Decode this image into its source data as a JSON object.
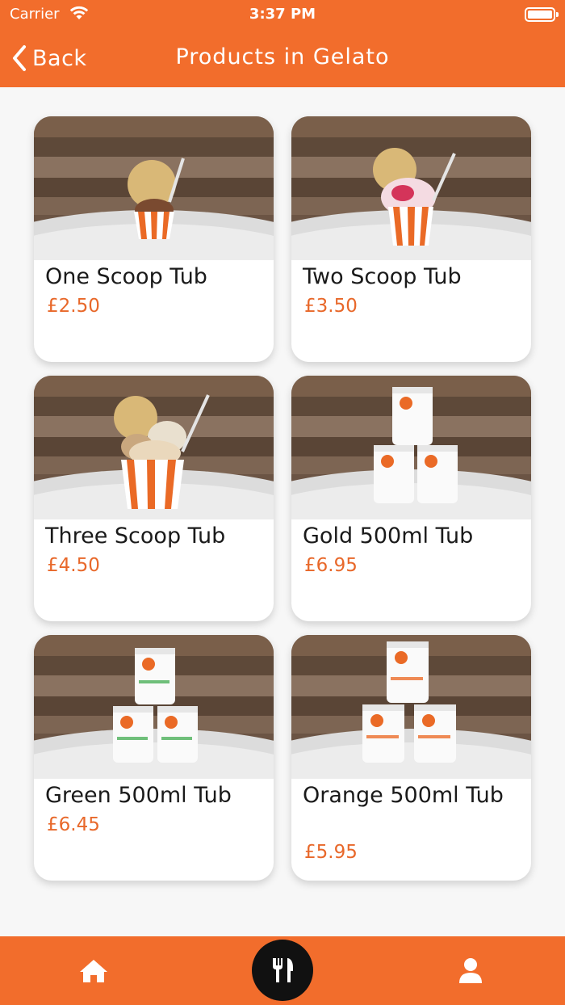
{
  "status_bar": {
    "carrier": "Carrier",
    "time": "3:37 PM"
  },
  "nav": {
    "back_label": "Back",
    "title": "Products in Gelato"
  },
  "products": [
    {
      "name": "One Scoop Tub",
      "price": "£2.50"
    },
    {
      "name": "Two Scoop Tub",
      "price": "£3.50"
    },
    {
      "name": "Three Scoop Tub",
      "price": "£4.50"
    },
    {
      "name": "Gold 500ml Tub",
      "price": "£6.95"
    },
    {
      "name": "Green 500ml Tub",
      "price": "£6.45"
    },
    {
      "name": "Orange 500ml Tub",
      "price": "£5.95"
    }
  ],
  "tabs": {
    "home": "home-icon",
    "menu": "fork-knife-icon",
    "profile": "user-icon"
  },
  "colors": {
    "brand": "#f26d2c",
    "price": "#e8682a"
  }
}
